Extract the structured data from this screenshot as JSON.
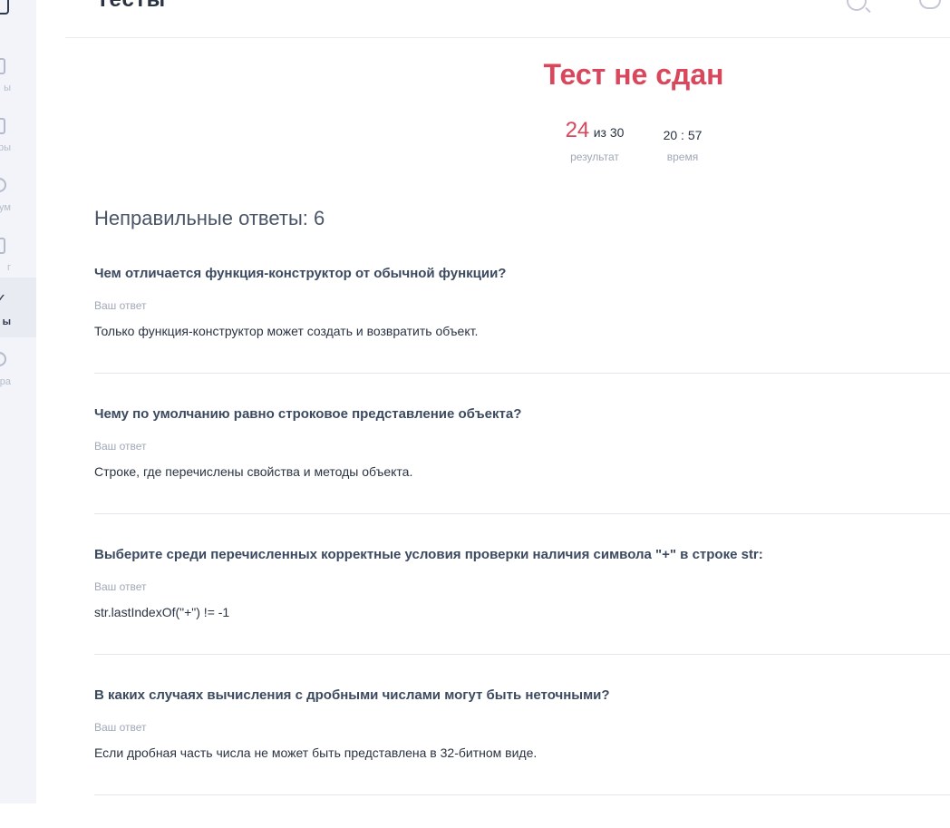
{
  "header": {
    "title": "Тесты"
  },
  "sidebar": {
    "items": [
      {
        "label": "ы",
        "icon": "file-icon"
      },
      {
        "label": "ары",
        "icon": "calendar-icon"
      },
      {
        "label": "ум",
        "icon": "chat-icon"
      },
      {
        "label": "г",
        "icon": "book-icon"
      },
      {
        "label": "ы",
        "icon": "check-icon",
        "active": true
      },
      {
        "label": "ера",
        "icon": "pin-icon"
      }
    ]
  },
  "result": {
    "title": "Тест не сдан",
    "score": "24",
    "score_of": "из 30",
    "score_caption": "результат",
    "time": "20 : 57",
    "time_caption": "время"
  },
  "wrong": {
    "heading": "Неправильные ответы: 6",
    "your_answer_label": "Ваш ответ",
    "items": [
      {
        "question": "Чем отличается функция-конструктор от обычной функции?",
        "answer": "Только функция-конструктор может создать и возвратить объект."
      },
      {
        "question": "Чему по умолчанию равно строковое представление объекта?",
        "answer": "Строке, где перечислены свойства и методы объекта."
      },
      {
        "question": "Выберите среди перечисленных корректные условия проверки наличия символа \"+\" в строке str:",
        "answer": "str.lastIndexOf(\"+\") != -1"
      },
      {
        "question": "В каких случаях вычисления с дробными числами могут быть неточными?",
        "answer": "Если дробная часть числа не может быть представлена в 32-битном виде."
      }
    ]
  },
  "colors": {
    "fail": "#d9475c",
    "sidebar_bg": "#f2f4f9"
  }
}
